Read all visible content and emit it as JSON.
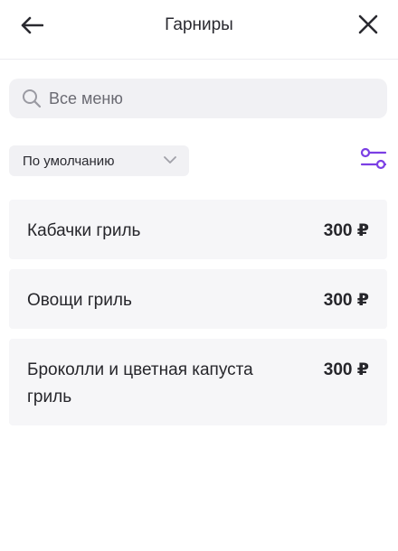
{
  "header": {
    "title": "Гарниры",
    "back_icon": "arrow-left-icon",
    "close_icon": "close-icon"
  },
  "search": {
    "placeholder": "Все меню",
    "icon": "search-icon"
  },
  "sort": {
    "selected": "По умолчанию",
    "icon": "chevron-down-icon"
  },
  "filter": {
    "icon": "filter-sliders-icon",
    "color": "#7b3fe4"
  },
  "items": [
    {
      "name": "Кабачки гриль",
      "price": "300 ₽"
    },
    {
      "name": "Овощи гриль",
      "price": "300 ₽"
    },
    {
      "name": "Броколли и цветная капуста гриль",
      "price": "300 ₽"
    }
  ]
}
